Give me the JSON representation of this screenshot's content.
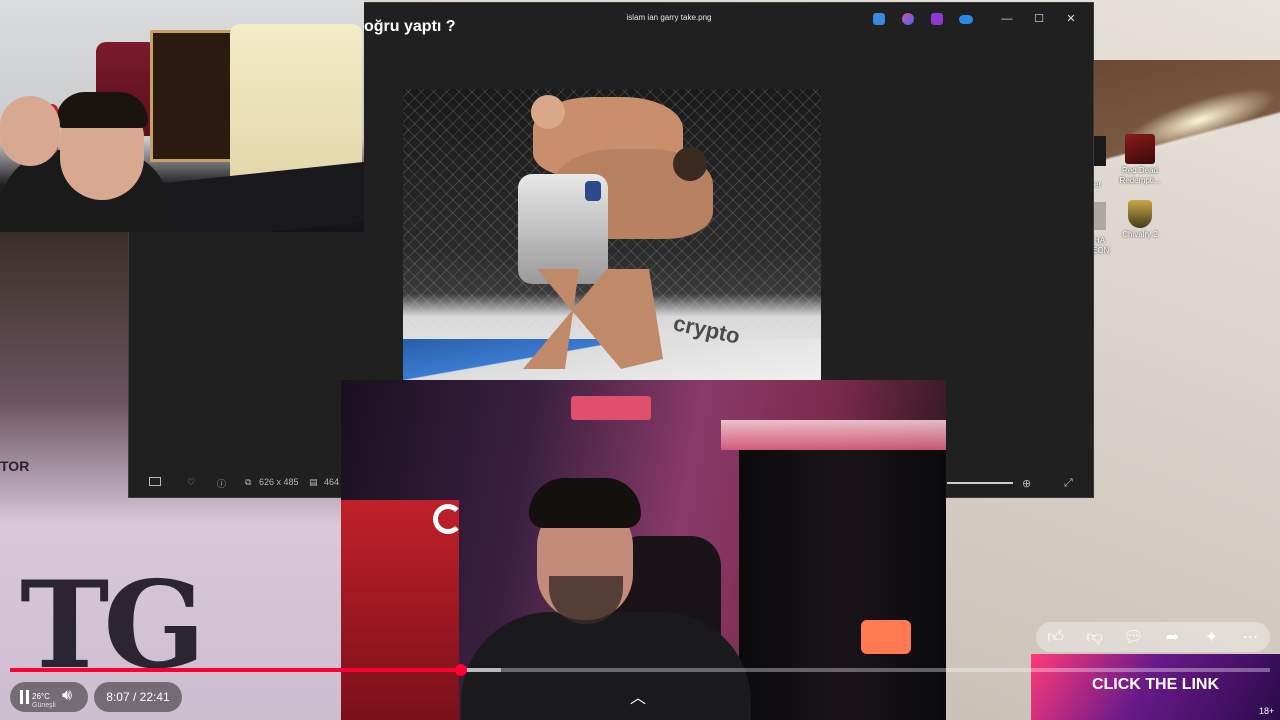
{
  "viewer": {
    "title": "islam ian garry take.png",
    "dimensions": "626 x 485",
    "size": "464",
    "app_icons": [
      "designer-icon",
      "copilot-icon",
      "clipchamp-icon",
      "onedrive-icon"
    ]
  },
  "overlay": {
    "heading": "oğru yaptı ?"
  },
  "desktop": {
    "icons": [
      {
        "label": "Red Dead Redempti..."
      },
      {
        "label": "Chivalry 2"
      }
    ],
    "partial_labels": [
      "er",
      "HA",
      "EON"
    ]
  },
  "weather": {
    "temp": "26°C",
    "condition": "Güneşli"
  },
  "player": {
    "time": "8:07 / 22:41",
    "progress_fraction": 0.3578,
    "buffered_fraction": 0.39,
    "accent": "#ff0033"
  },
  "promo": {
    "text": "CLICK THE LINK",
    "age": "18+"
  },
  "actions": [
    "like-icon",
    "dislike-icon",
    "comment-icon",
    "share-icon",
    "remix-icon",
    "more-icon"
  ]
}
